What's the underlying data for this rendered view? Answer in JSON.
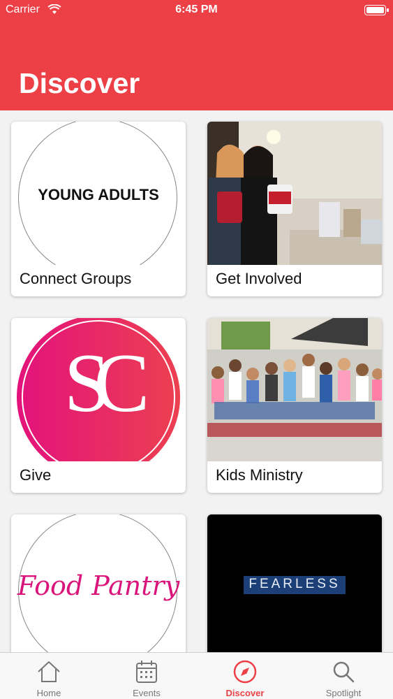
{
  "status_bar": {
    "carrier": "Carrier",
    "time": "6:45 PM"
  },
  "header": {
    "title": "Discover"
  },
  "cards": [
    {
      "label": "Connect Groups",
      "image_text": "YOUNG ADULTS"
    },
    {
      "label": "Get Involved"
    },
    {
      "label": "Give",
      "image_text": "SC"
    },
    {
      "label": "Kids Ministry"
    },
    {
      "label": "",
      "image_text": "Food Pantry"
    },
    {
      "label": "",
      "image_text": "FEARLESS"
    }
  ],
  "tab_bar": {
    "tabs": [
      {
        "label": "Home",
        "icon": "home-icon"
      },
      {
        "label": "Events",
        "icon": "calendar-icon"
      },
      {
        "label": "Discover",
        "icon": "compass-icon",
        "active": true
      },
      {
        "label": "Spotlight",
        "icon": "search-icon"
      }
    ]
  },
  "colors": {
    "accent": "#ec3f46",
    "inactive": "#777777",
    "brand_pink": "#e3127c"
  }
}
